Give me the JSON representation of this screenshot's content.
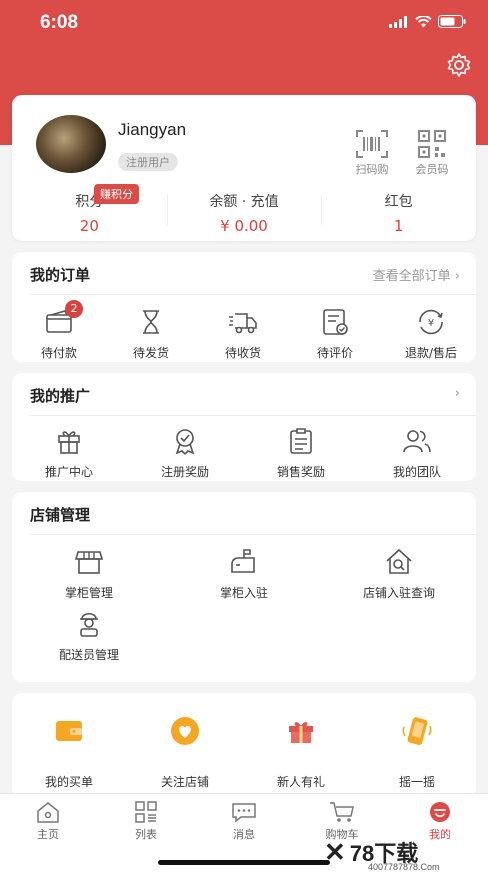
{
  "status_bar": {
    "time": "6:08"
  },
  "profile": {
    "username": "Jiangyan",
    "user_tag": "注册用户",
    "scan_label": "扫码购",
    "member_code_label": "会员码",
    "earn_badge": "赚积分",
    "stats": [
      {
        "label": "积分",
        "value": "20"
      },
      {
        "label": "余额 · 充值",
        "value": "¥ 0.00"
      },
      {
        "label": "红包",
        "value": "1"
      }
    ]
  },
  "orders": {
    "title": "我的订单",
    "view_all": "查看全部订单",
    "items": [
      {
        "label": "待付款",
        "icon": "wallet-icon",
        "badge": "2"
      },
      {
        "label": "待发货",
        "icon": "hourglass-icon"
      },
      {
        "label": "待收货",
        "icon": "truck-icon"
      },
      {
        "label": "待评价",
        "icon": "review-icon"
      },
      {
        "label": "退款/售后",
        "icon": "refund-icon"
      }
    ]
  },
  "promotion": {
    "title": "我的推广",
    "items": [
      {
        "label": "推广中心",
        "icon": "gift-icon"
      },
      {
        "label": "注册奖励",
        "icon": "medal-icon"
      },
      {
        "label": "销售奖励",
        "icon": "list-icon"
      },
      {
        "label": "我的团队",
        "icon": "team-icon"
      }
    ]
  },
  "store": {
    "title": "店铺管理",
    "items": [
      {
        "label": "掌柜管理",
        "icon": "shop-icon"
      },
      {
        "label": "掌柜入驻",
        "icon": "mailbox-icon"
      },
      {
        "label": "店铺入驻查询",
        "icon": "house-search-icon"
      },
      {
        "label": "配送员管理",
        "icon": "courier-icon"
      }
    ]
  },
  "extras": {
    "items": [
      {
        "label": "我的买单",
        "icon": "bill-icon"
      },
      {
        "label": "关注店铺",
        "icon": "heart-icon"
      },
      {
        "label": "新人有礼",
        "icon": "present-icon"
      },
      {
        "label": "摇一摇",
        "icon": "shake-icon"
      }
    ]
  },
  "tabbar": {
    "tabs": [
      {
        "label": "主页",
        "icon": "home-icon"
      },
      {
        "label": "列表",
        "icon": "grid-icon"
      },
      {
        "label": "消息",
        "icon": "message-icon"
      },
      {
        "label": "购物车",
        "icon": "cart-icon"
      },
      {
        "label": "我的",
        "icon": "profile-icon",
        "active": true
      }
    ]
  },
  "watermark": {
    "text": "78下载",
    "url": "4007787878.Com"
  },
  "colors": {
    "brand_red": "#db4b48",
    "accent_orange": "#f5a623"
  }
}
